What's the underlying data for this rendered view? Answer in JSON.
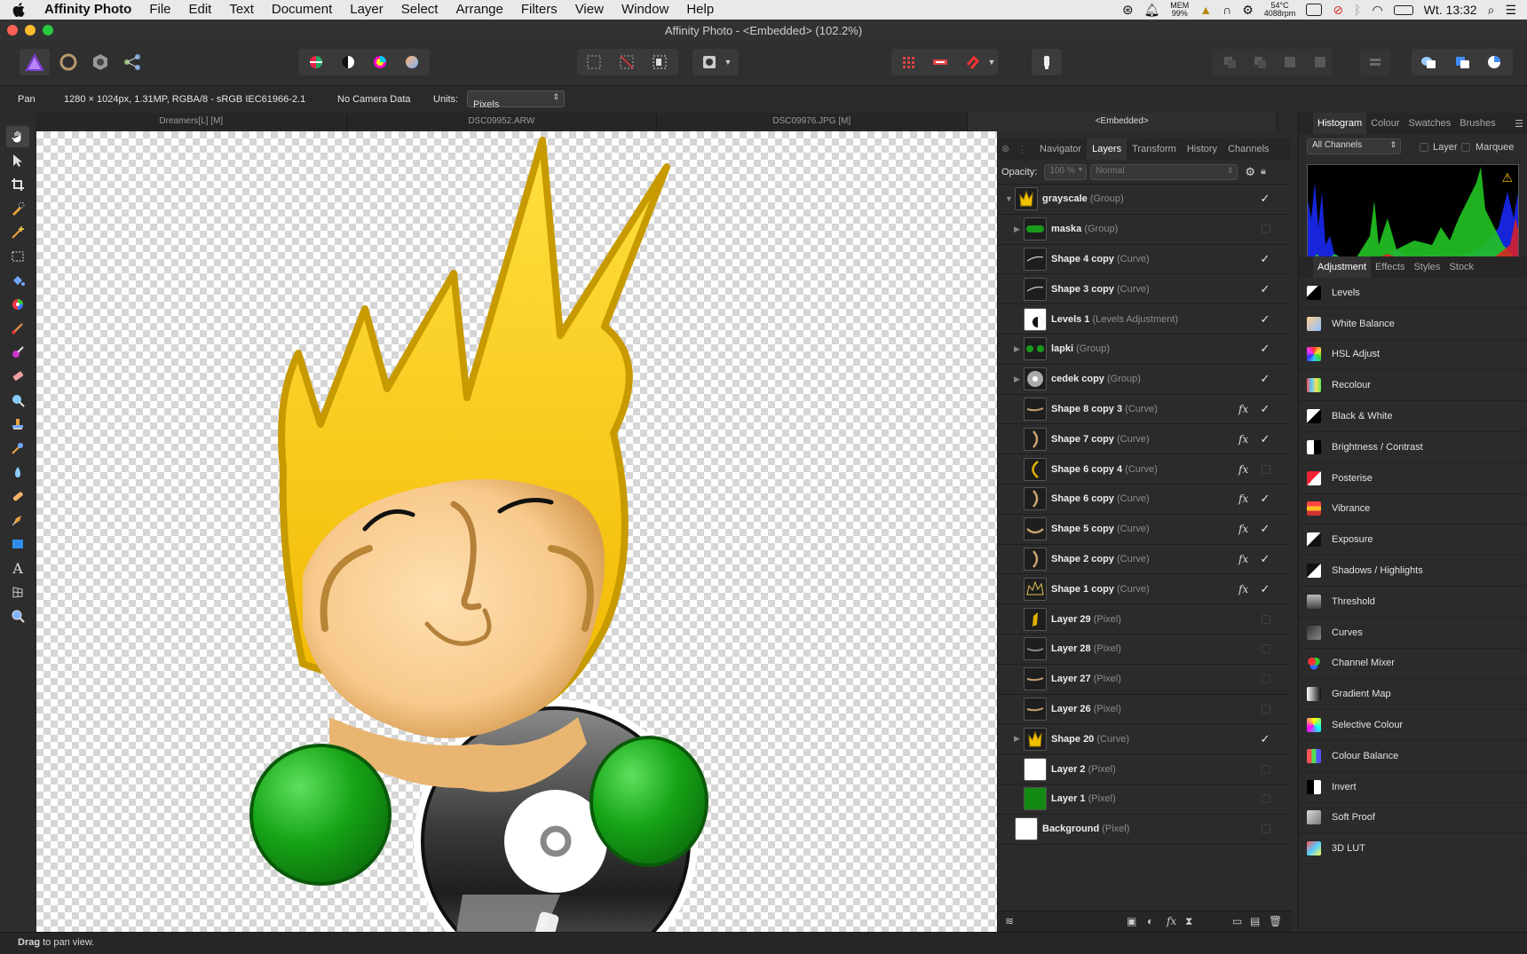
{
  "menubar": {
    "app": "Affinity Photo",
    "items": [
      "File",
      "Edit",
      "Text",
      "Document",
      "Layer",
      "Select",
      "Arrange",
      "Filters",
      "View",
      "Window",
      "Help"
    ],
    "mem_label": "MEM",
    "mem_value": "99%",
    "temp": "54°C",
    "rpm": "4088rpm",
    "clock": "Wt. 13:32"
  },
  "window": {
    "title": "Affinity Photo - <Embedded> (102.2%)"
  },
  "context": {
    "tool": "Pan",
    "doc_info": "1280 × 1024px, 1.31MP, RGBA/8 - sRGB IEC61966-2.1",
    "camera": "No Camera Data",
    "units_label": "Units:",
    "units_value": "Pixels"
  },
  "doc_tabs": [
    "Dreamers[L] [M]",
    "DSC09952.ARW",
    "DSC09976.JPG [M]",
    "<Embedded>"
  ],
  "layers_panel": {
    "tabs": [
      "Navigator",
      "Layers",
      "Transform",
      "History",
      "Channels"
    ],
    "active_tab": "Layers",
    "opacity_label": "Opacity:",
    "opacity_value": "100 %",
    "blend_mode": "Normal",
    "layers": [
      {
        "name": "grayscale",
        "type": "(Group)",
        "expand": "open",
        "indent": 0,
        "fx": false,
        "visible": true,
        "thumb": "crown"
      },
      {
        "name": "maska",
        "type": "(Group)",
        "expand": "closed",
        "indent": 1,
        "fx": false,
        "visible": false,
        "thumb": "green-strip"
      },
      {
        "name": "Shape 4 copy",
        "type": "(Curve)",
        "expand": "none",
        "indent": 1,
        "fx": false,
        "visible": true,
        "thumb": "stroke"
      },
      {
        "name": "Shape 3 copy",
        "type": "(Curve)",
        "expand": "none",
        "indent": 1,
        "fx": false,
        "visible": true,
        "thumb": "stroke"
      },
      {
        "name": "Levels 1",
        "type": "(Levels Adjustment)",
        "expand": "none",
        "indent": 1,
        "fx": false,
        "visible": true,
        "thumb": "levels"
      },
      {
        "name": "lapki",
        "type": "(Group)",
        "expand": "closed",
        "indent": 1,
        "fx": false,
        "visible": true,
        "thumb": "paws"
      },
      {
        "name": "cedek copy",
        "type": "(Group)",
        "expand": "closed",
        "indent": 1,
        "fx": false,
        "visible": true,
        "thumb": "disc"
      },
      {
        "name": "Shape 8 copy 3",
        "type": "(Curve)",
        "expand": "none",
        "indent": 1,
        "fx": true,
        "visible": true,
        "thumb": "tan-stroke"
      },
      {
        "name": "Shape 7 copy",
        "type": "(Curve)",
        "expand": "none",
        "indent": 1,
        "fx": true,
        "visible": true,
        "thumb": "tan-arc"
      },
      {
        "name": "Shape 6 copy 4",
        "type": "(Curve)",
        "expand": "none",
        "indent": 1,
        "fx": true,
        "visible": false,
        "thumb": "yellow-arc"
      },
      {
        "name": "Shape 6 copy",
        "type": "(Curve)",
        "expand": "none",
        "indent": 1,
        "fx": true,
        "visible": true,
        "thumb": "tan-arc"
      },
      {
        "name": "Shape 5 copy",
        "type": "(Curve)",
        "expand": "none",
        "indent": 1,
        "fx": true,
        "visible": true,
        "thumb": "tan-smile"
      },
      {
        "name": "Shape 2 copy",
        "type": "(Curve)",
        "expand": "none",
        "indent": 1,
        "fx": true,
        "visible": true,
        "thumb": "tan-arc"
      },
      {
        "name": "Shape 1 copy",
        "type": "(Curve)",
        "expand": "none",
        "indent": 1,
        "fx": true,
        "visible": true,
        "thumb": "crown-outline"
      },
      {
        "name": "Layer 29",
        "type": "(Pixel)",
        "expand": "none",
        "indent": 1,
        "fx": false,
        "visible": false,
        "thumb": "yellow-blob"
      },
      {
        "name": "Layer 28",
        "type": "(Pixel)",
        "expand": "none",
        "indent": 1,
        "fx": false,
        "visible": false,
        "thumb": "grey-stroke"
      },
      {
        "name": "Layer 27",
        "type": "(Pixel)",
        "expand": "none",
        "indent": 1,
        "fx": false,
        "visible": false,
        "thumb": "tan-stroke"
      },
      {
        "name": "Layer 26",
        "type": "(Pixel)",
        "expand": "none",
        "indent": 1,
        "fx": false,
        "visible": false,
        "thumb": "tan-stroke"
      },
      {
        "name": "Shape 20",
        "type": "(Curve)",
        "expand": "closed",
        "indent": 1,
        "fx": false,
        "visible": true,
        "thumb": "crown"
      },
      {
        "name": "Layer 2",
        "type": "(Pixel)",
        "expand": "none",
        "indent": 1,
        "fx": false,
        "visible": false,
        "thumb": "white"
      },
      {
        "name": "Layer 1",
        "type": "(Pixel)",
        "expand": "none",
        "indent": 1,
        "fx": false,
        "visible": false,
        "thumb": "green"
      },
      {
        "name": "Background",
        "type": "(Pixel)",
        "expand": "none",
        "indent": 0,
        "fx": false,
        "visible": false,
        "thumb": "white"
      }
    ]
  },
  "histogram_panel": {
    "tabs": [
      "Histogram",
      "Colour",
      "Swatches",
      "Brushes"
    ],
    "active_tab": "Histogram",
    "channel": "All Channels",
    "layer_label": "Layer",
    "marquee_label": "Marquee"
  },
  "adjustment_panel": {
    "tabs": [
      "Adjustment",
      "Effects",
      "Styles",
      "Stock"
    ],
    "active_tab": "Adjustment",
    "items": [
      {
        "label": "Levels",
        "icon": "levels-icon"
      },
      {
        "label": "White Balance",
        "icon": "white-balance-icon"
      },
      {
        "label": "HSL Adjust",
        "icon": "hsl-icon"
      },
      {
        "label": "Recolour",
        "icon": "recolour-icon"
      },
      {
        "label": "Black & White",
        "icon": "black-white-icon"
      },
      {
        "label": "Brightness / Contrast",
        "icon": "brightness-contrast-icon"
      },
      {
        "label": "Posterise",
        "icon": "posterise-icon"
      },
      {
        "label": "Vibrance",
        "icon": "vibrance-icon"
      },
      {
        "label": "Exposure",
        "icon": "exposure-icon"
      },
      {
        "label": "Shadows / Highlights",
        "icon": "shadows-highlights-icon"
      },
      {
        "label": "Threshold",
        "icon": "threshold-icon"
      },
      {
        "label": "Curves",
        "icon": "curves-icon"
      },
      {
        "label": "Channel Mixer",
        "icon": "channel-mixer-icon"
      },
      {
        "label": "Gradient Map",
        "icon": "gradient-map-icon"
      },
      {
        "label": "Selective Colour",
        "icon": "selective-colour-icon"
      },
      {
        "label": "Colour Balance",
        "icon": "colour-balance-icon"
      },
      {
        "label": "Invert",
        "icon": "invert-icon"
      },
      {
        "label": "Soft Proof",
        "icon": "soft-proof-icon"
      },
      {
        "label": "3D LUT",
        "icon": "3d-lut-icon"
      }
    ]
  },
  "status": {
    "bold": "Drag",
    "text": " to pan view."
  },
  "colors": {
    "accent": "#3f7fd8",
    "crown": "#f2c200",
    "paw": "#12a012",
    "skin": "#f3c990"
  }
}
